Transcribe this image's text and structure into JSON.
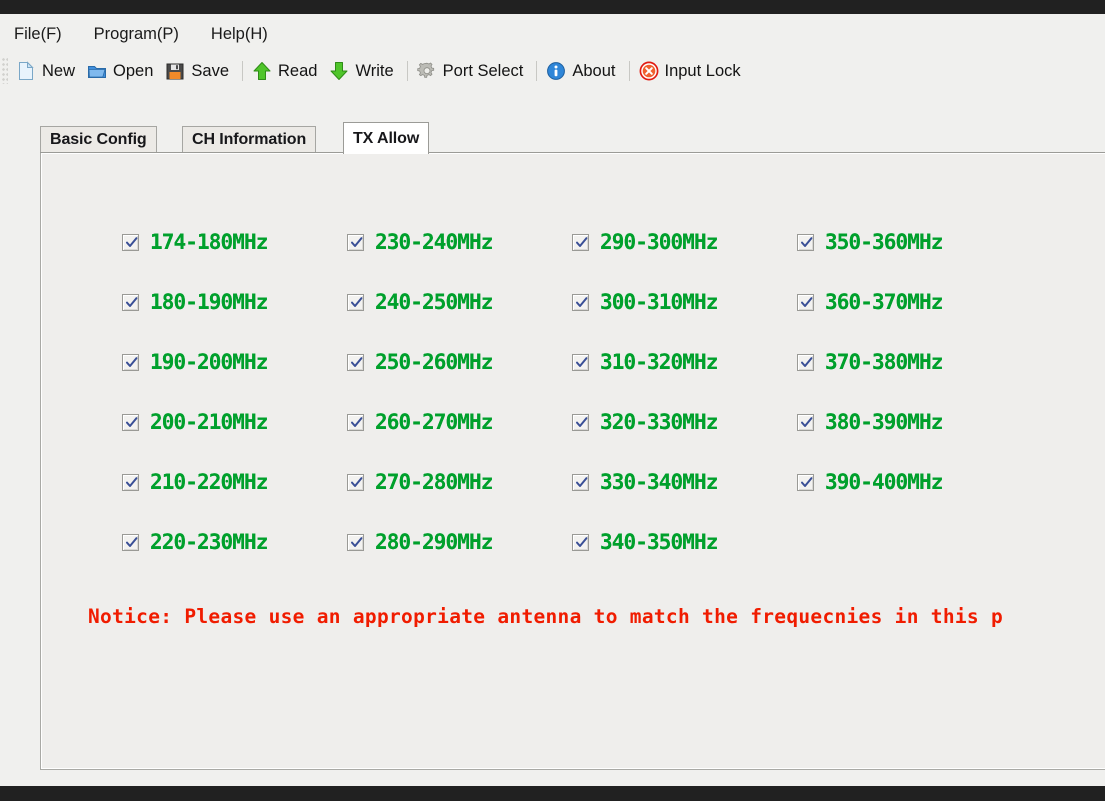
{
  "menu": {
    "items": [
      {
        "label": "File(F)",
        "name": "menu-file"
      },
      {
        "label": "Program(P)",
        "name": "menu-program"
      },
      {
        "label": "Help(H)",
        "name": "menu-help"
      }
    ]
  },
  "toolbar": {
    "buttons": [
      {
        "label": "New",
        "icon": "new-document-icon"
      },
      {
        "label": "Open",
        "icon": "open-folder-icon"
      },
      {
        "label": "Save",
        "icon": "floppy-disk-icon"
      },
      {
        "label": "Read",
        "icon": "green-up-arrow-icon"
      },
      {
        "label": "Write",
        "icon": "green-down-arrow-icon"
      },
      {
        "label": "Port Select",
        "icon": "gear-icon"
      },
      {
        "label": "About",
        "icon": "info-circle-icon"
      },
      {
        "label": "Input Lock",
        "icon": "red-x-circle-icon"
      }
    ]
  },
  "tabs": [
    {
      "label": "Basic Config",
      "active": false
    },
    {
      "label": "CH Information",
      "active": false
    },
    {
      "label": "TX Allow",
      "active": true
    }
  ],
  "tx_allow": {
    "columns": [
      [
        {
          "label": "174-180MHz",
          "checked": true
        },
        {
          "label": "180-190MHz",
          "checked": true
        },
        {
          "label": "190-200MHz",
          "checked": true
        },
        {
          "label": "200-210MHz",
          "checked": true
        },
        {
          "label": "210-220MHz",
          "checked": true
        },
        {
          "label": "220-230MHz",
          "checked": true
        }
      ],
      [
        {
          "label": "230-240MHz",
          "checked": true
        },
        {
          "label": "240-250MHz",
          "checked": true
        },
        {
          "label": "250-260MHz",
          "checked": true
        },
        {
          "label": "260-270MHz",
          "checked": true
        },
        {
          "label": "270-280MHz",
          "checked": true
        },
        {
          "label": "280-290MHz",
          "checked": true
        }
      ],
      [
        {
          "label": "290-300MHz",
          "checked": true
        },
        {
          "label": "300-310MHz",
          "checked": true
        },
        {
          "label": "310-320MHz",
          "checked": true
        },
        {
          "label": "320-330MHz",
          "checked": true
        },
        {
          "label": "330-340MHz",
          "checked": true
        },
        {
          "label": "340-350MHz",
          "checked": true
        }
      ],
      [
        {
          "label": "350-360MHz",
          "checked": true
        },
        {
          "label": "360-370MHz",
          "checked": true
        },
        {
          "label": "370-380MHz",
          "checked": true
        },
        {
          "label": "380-390MHz",
          "checked": true
        },
        {
          "label": "390-400MHz",
          "checked": true
        }
      ]
    ],
    "notice": "Notice: Please use an appropriate antenna to match the frequecnies in this p"
  },
  "colors": {
    "band_label": "#00a02c",
    "notice": "#f01c00",
    "window_bg": "#f0f0ee",
    "panel_bg": "#efeeec"
  }
}
